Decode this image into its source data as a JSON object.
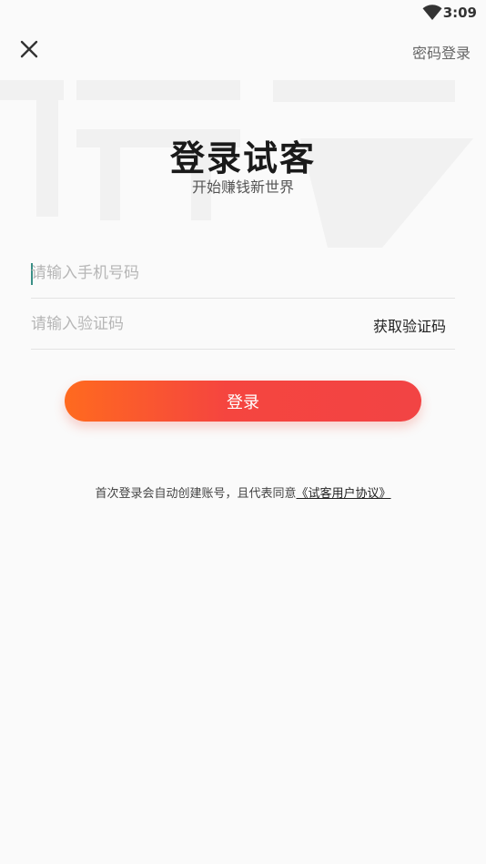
{
  "status_bar": {
    "time": "3:09",
    "wifi_icon": "wifi-icon"
  },
  "header": {
    "close_icon": "close-icon",
    "password_login": "密码登录"
  },
  "hero": {
    "title": "登录试客",
    "subtitle": "开始赚钱新世界"
  },
  "form": {
    "phone_placeholder": "请输入手机号码",
    "phone_value": "",
    "code_placeholder": "请输入验证码",
    "code_value": "",
    "get_code_label": "获取验证码"
  },
  "login_button": {
    "label": "登录"
  },
  "agreement": {
    "text": "首次登录会自动创建账号，且代表同意",
    "link_text": "《试客用户协议》"
  },
  "colors": {
    "gradient_start": "#ff6a1f",
    "gradient_end": "#f24444",
    "caret": "#3a8f86",
    "background": "#fafafa"
  }
}
